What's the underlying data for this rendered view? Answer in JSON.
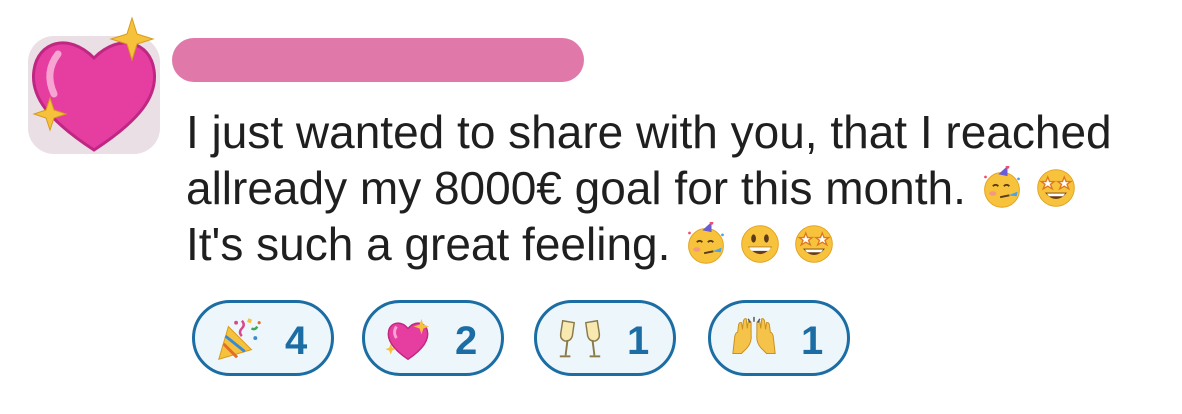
{
  "message": {
    "lines": [
      "I just wanted to share with you, that I reached",
      "allready my 8000€ goal for this month.",
      "It's such a great feeling."
    ],
    "line2_emojis": [
      "partying-face-emoji",
      "star-struck-emoji"
    ],
    "line3_emojis": [
      "partying-face-emoji",
      "grinning-face-emoji",
      "star-struck-emoji"
    ]
  },
  "reactions": [
    {
      "emoji": "party-popper-icon",
      "count": "4"
    },
    {
      "emoji": "sparkling-heart-icon",
      "count": "2"
    },
    {
      "emoji": "clinking-glasses-icon",
      "count": "1"
    },
    {
      "emoji": "raising-hands-icon",
      "count": "1"
    }
  ],
  "colors": {
    "reaction_border": "#1b6da3",
    "reaction_bg": "#edf6fb",
    "redaction": "#e079a9"
  }
}
